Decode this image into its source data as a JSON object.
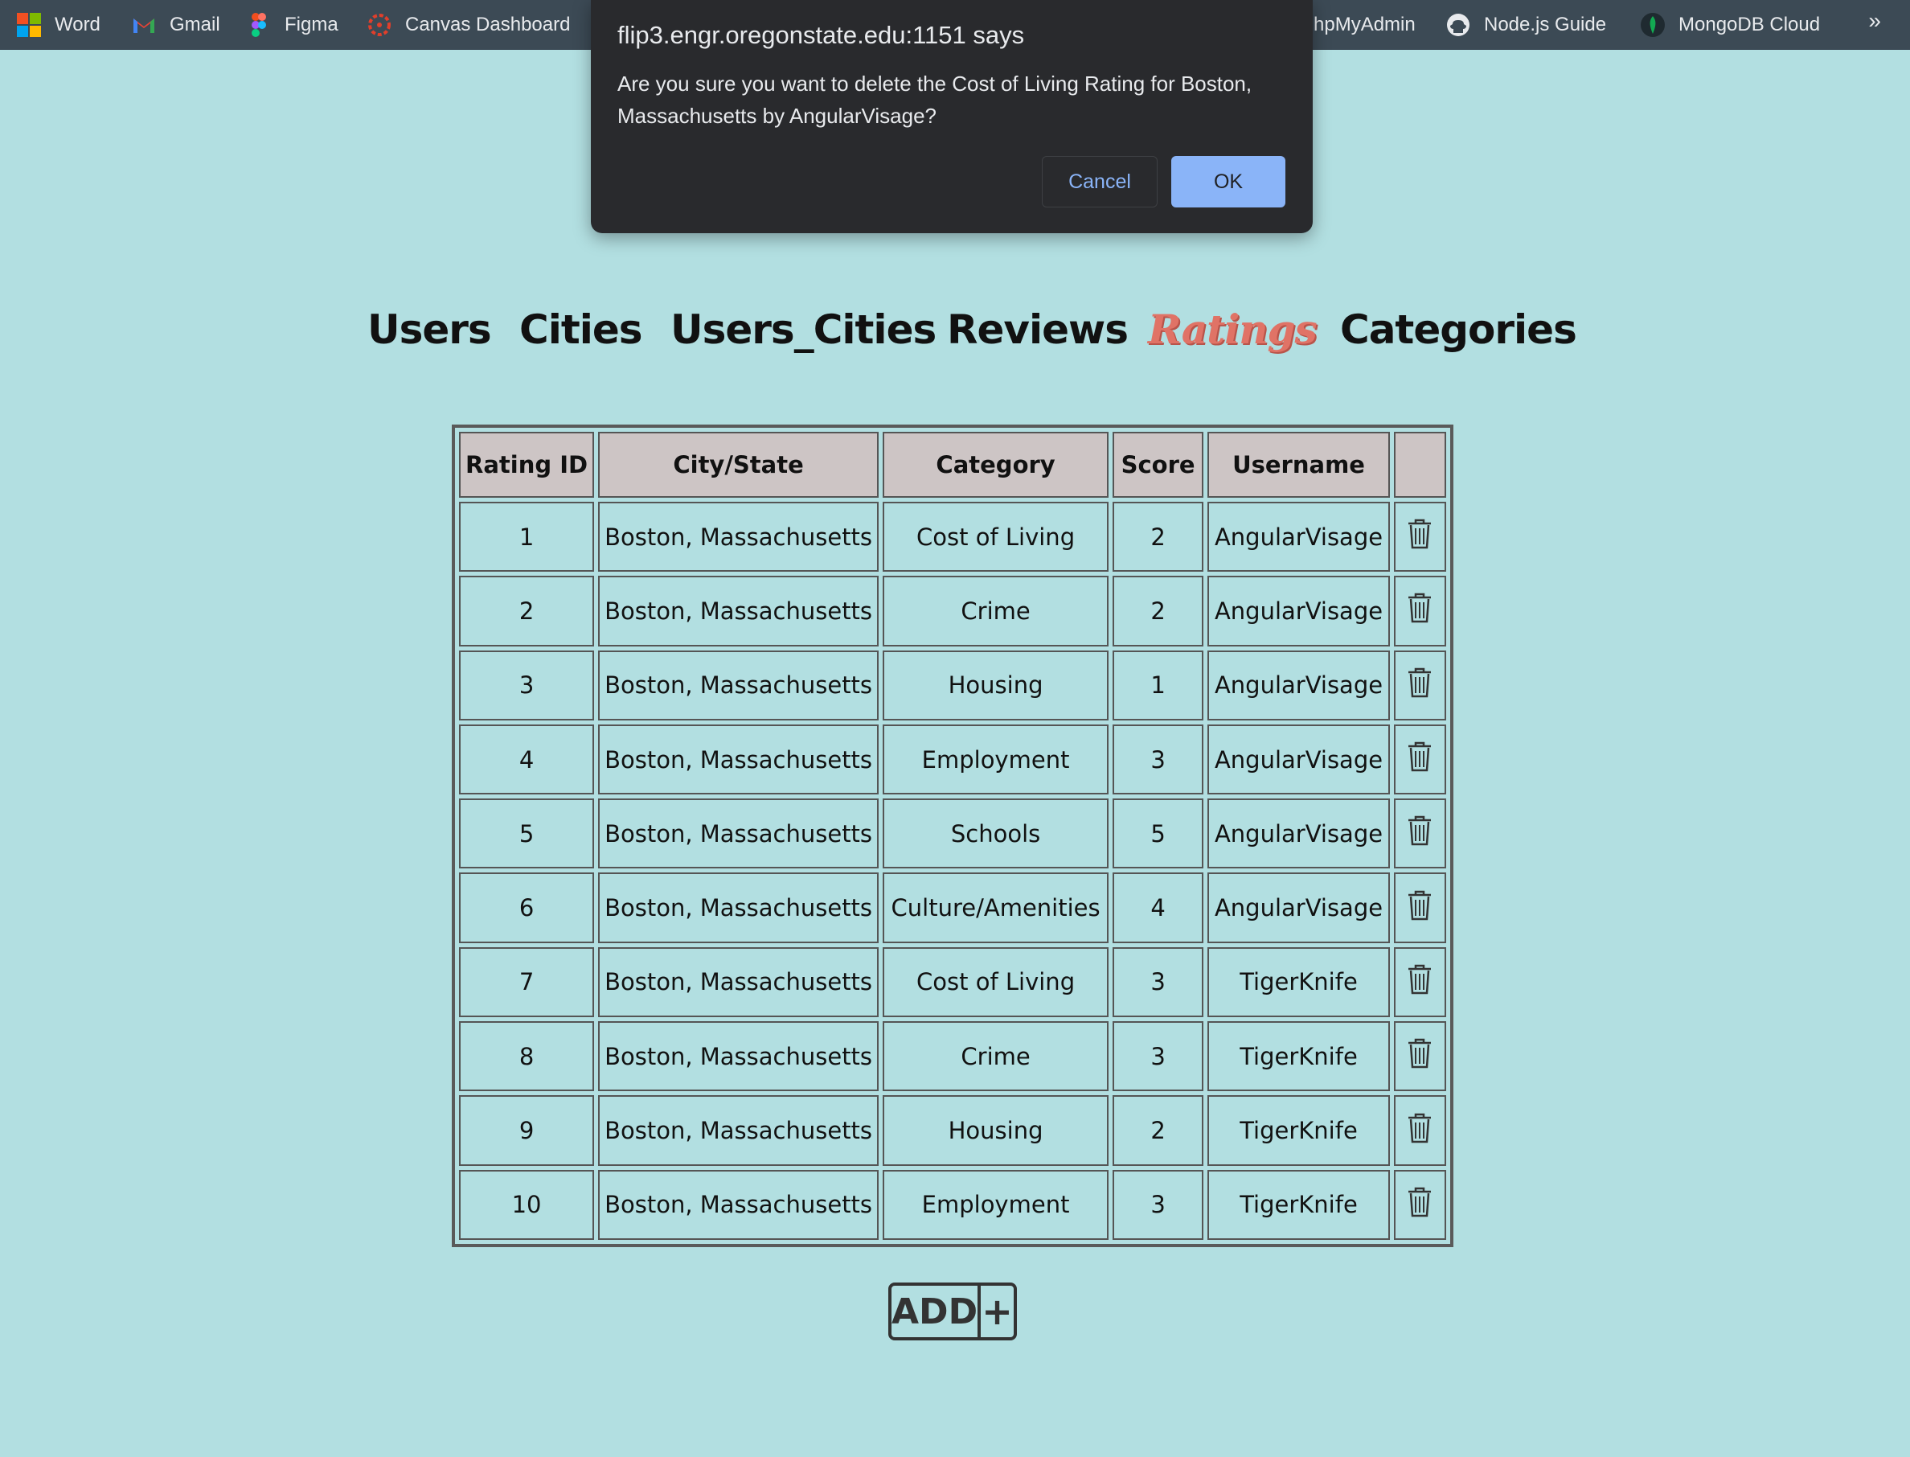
{
  "bookmarks": {
    "items": [
      {
        "label": "Word",
        "icon": "microsoft-icon"
      },
      {
        "label": "Gmail",
        "icon": "gmail-icon"
      },
      {
        "label": "Figma",
        "icon": "figma-icon"
      },
      {
        "label": "Canvas Dashboard",
        "icon": "canvas-icon"
      },
      {
        "label": "hpMyAdmin",
        "icon": "phpmyadmin-icon"
      },
      {
        "label": "Node.js Guide",
        "icon": "github-icon"
      },
      {
        "label": "MongoDB Cloud",
        "icon": "mongodb-icon"
      }
    ],
    "more": "»"
  },
  "dialog": {
    "title": "flip3.engr.oregonstate.edu:1151 says",
    "message": "Are you sure you want to delete the Cost of Living Rating for Boston, Massachusetts by AngularVisage?",
    "cancel_label": "Cancel",
    "ok_label": "OK"
  },
  "nav": {
    "items": [
      "Users",
      "Cities",
      "Users_Cities",
      "Reviews",
      "Ratings",
      "Categories"
    ],
    "active": "Ratings"
  },
  "table": {
    "headers": [
      "Rating ID",
      "City/State",
      "Category",
      "Score",
      "Username",
      ""
    ],
    "rows": [
      [
        "1",
        "Boston, Massachusetts",
        "Cost of Living",
        "2",
        "AngularVisage"
      ],
      [
        "2",
        "Boston, Massachusetts",
        "Crime",
        "2",
        "AngularVisage"
      ],
      [
        "3",
        "Boston, Massachusetts",
        "Housing",
        "1",
        "AngularVisage"
      ],
      [
        "4",
        "Boston, Massachusetts",
        "Employment",
        "3",
        "AngularVisage"
      ],
      [
        "5",
        "Boston, Massachusetts",
        "Schools",
        "5",
        "AngularVisage"
      ],
      [
        "6",
        "Boston, Massachusetts",
        "Culture/Amenities",
        "4",
        "AngularVisage"
      ],
      [
        "7",
        "Boston, Massachusetts",
        "Cost of Living",
        "3",
        "TigerKnife"
      ],
      [
        "8",
        "Boston, Massachusetts",
        "Crime",
        "3",
        "TigerKnife"
      ],
      [
        "9",
        "Boston, Massachusetts",
        "Housing",
        "2",
        "TigerKnife"
      ],
      [
        "10",
        "Boston, Massachusetts",
        "Employment",
        "3",
        "TigerKnife"
      ]
    ]
  },
  "add_button": {
    "label": "ADD",
    "plus": "+"
  },
  "colors": {
    "page_bg": "#b2dfe1",
    "active_nav": "#e07366",
    "header_bg": "#cdc5c5",
    "dialog_bg": "#292a2d",
    "ok_button": "#8ab4f8"
  }
}
